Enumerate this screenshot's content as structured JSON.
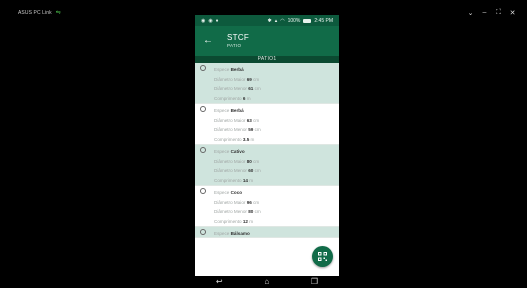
{
  "host": {
    "title": "ASUS PC Link",
    "controls": [
      "⌄",
      "–",
      "⛶",
      "✕"
    ]
  },
  "status_bar": {
    "left_icons": [
      "◉",
      "◉",
      "♦"
    ],
    "right_text": "100%",
    "time": "2:45 PM"
  },
  "app_bar": {
    "title": "STCF",
    "subtitle": "PATIO"
  },
  "section_header": "PATIO1",
  "labels": {
    "especie": "Espece",
    "diametro_maior": "Diâmetro Maior",
    "diametro_menor": "Diâmetro Menor",
    "comprimento": "Comprimento",
    "unit_cm": "cm",
    "unit_m": "m"
  },
  "items": [
    {
      "especie": "Berbá",
      "diametro_maior": "69",
      "diametro_menor": "61",
      "comprimento": "6"
    },
    {
      "especie": "Berbá",
      "diametro_maior": "63",
      "diametro_menor": "59",
      "comprimento": "3.5"
    },
    {
      "especie": "Cativo",
      "diametro_maior": "80",
      "diametro_menor": "60",
      "comprimento": "14"
    },
    {
      "especie": "Coco",
      "diametro_maior": "96",
      "diametro_menor": "80",
      "comprimento": "12"
    },
    {
      "especie": "Bálsamo"
    }
  ],
  "colors": {
    "status_bar": "#0d5a3d",
    "app_bar": "#116b48",
    "section_header": "#0b4a31",
    "shaded_row": "#cfe4dd",
    "fab": "#116b48"
  },
  "icons": {
    "back": "arrow-left-icon",
    "fab": "qr-scan-icon",
    "nav": [
      "back-icon",
      "home-icon",
      "recents-icon"
    ]
  }
}
